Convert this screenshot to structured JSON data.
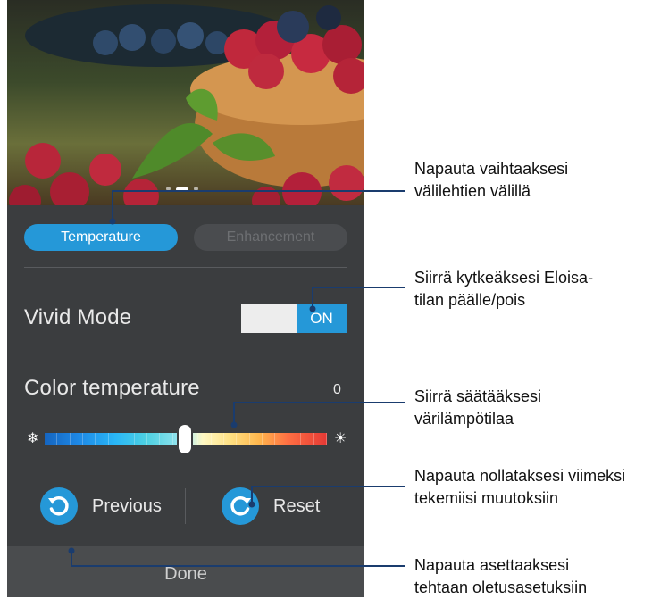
{
  "tabs": {
    "temperature": "Temperature",
    "enhancement": "Enhancement"
  },
  "vivid_mode": {
    "label": "Vivid Mode",
    "state": "ON"
  },
  "color_temperature": {
    "label": "Color temperature",
    "value": "0",
    "left_icon": "snowflake-icon",
    "right_icon": "sun-icon"
  },
  "actions": {
    "previous": "Previous",
    "reset": "Reset",
    "done": "Done"
  },
  "colors": {
    "accent": "#2598d8",
    "panel": "#3b3d3f",
    "callout_line": "#1a3c6e"
  },
  "callouts": [
    {
      "line1": "Napauta vaihtaaksesi",
      "line2": "välilehtien välillä"
    },
    {
      "line1": "Siirrä kytkeäksesi Eloisa-",
      "line2": "tilan päälle/pois"
    },
    {
      "line1": "Siirrä säätääksesi",
      "line2": "värilämpötilaa"
    },
    {
      "line1": "Napauta nollataksesi viimeksi",
      "line2": "tekemiisi muutoksiin"
    },
    {
      "line1": "Napauta asettaaksesi",
      "line2": "tehtaan oletusasetuksiin"
    }
  ]
}
